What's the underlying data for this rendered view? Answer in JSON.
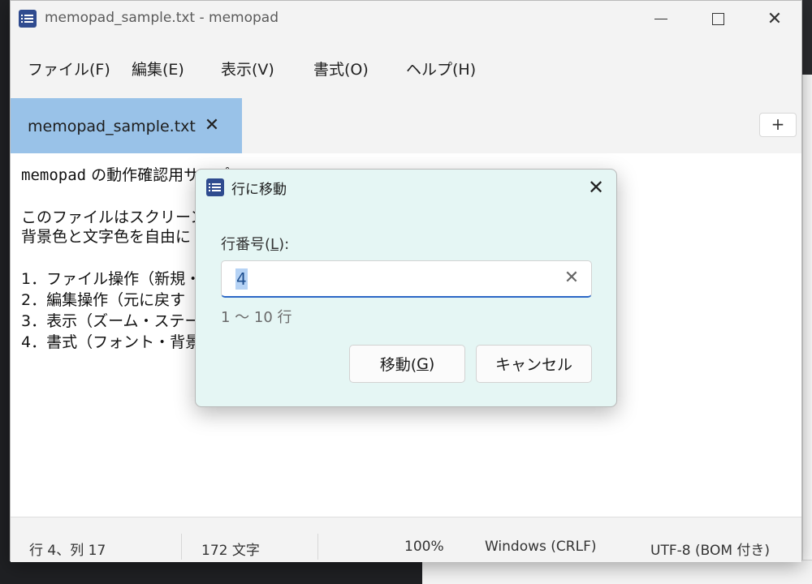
{
  "window": {
    "title": "memopad_sample.txt - memopad",
    "minimize_glyph": "—",
    "maximize_glyph": "□",
    "close_glyph": "✕"
  },
  "menu": [
    {
      "label": "ファイル(F)"
    },
    {
      "label": "編集(E)"
    },
    {
      "label": "表示(V)"
    },
    {
      "label": "書式(O)"
    },
    {
      "label": "ヘルプ(H)"
    }
  ],
  "tabs": {
    "active_label": "memopad_sample.txt",
    "close_glyph": "✕",
    "add_glyph": "+"
  },
  "editor": {
    "line1_mono": "memopad",
    "line1_rest": " の動作確認用サンプル",
    "lines": [
      "このファイルはスクリーンショ",
      "背景色と文字色を自由に",
      "",
      "1．ファイル操作（新規・",
      "2．編集操作（元に戻す",
      "3．表示（ズーム・ステータ",
      "4．書式（フォント・背景"
    ]
  },
  "status": {
    "position": "行 4、列 17",
    "chars": "172 文字",
    "zoom": "100%",
    "line_ending": "Windows (CRLF)",
    "encoding": "UTF-8 (BOM 付き)"
  },
  "dialog": {
    "title": "行に移動",
    "close_glyph": "✕",
    "label_prefix": "行番号(",
    "label_key": "L",
    "label_suffix": "):",
    "input_value": "4",
    "clear_glyph": "✕",
    "hint": "1 ～ 10 行",
    "ok_prefix": "移動(",
    "ok_key": "G",
    "ok_suffix": ")",
    "cancel_label": "キャンセル"
  },
  "colors": {
    "tab_active": "#99c2e8",
    "dialog_bg": "#e5f6f4",
    "accent": "#2b67c6",
    "selection": "#b6d3f5"
  },
  "icons": {
    "app": "notepad-icon",
    "dialog": "notepad-icon"
  }
}
